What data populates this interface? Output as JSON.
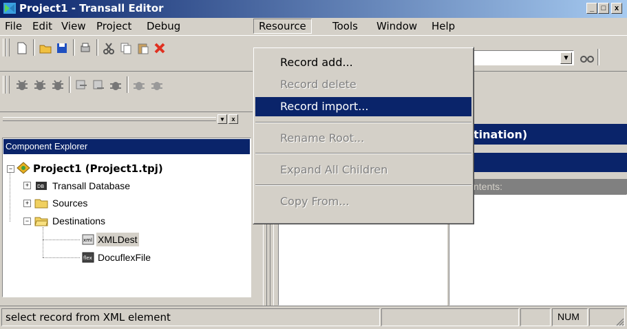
{
  "window": {
    "title": "Project1 - Transall Editor",
    "minimize": "_",
    "maximize": "□",
    "close": "x"
  },
  "menubar": [
    {
      "label": "File"
    },
    {
      "label": "Edit"
    },
    {
      "label": "View"
    },
    {
      "label": "Project"
    },
    {
      "label": "Debug"
    },
    {
      "label": "Resource"
    },
    {
      "label": "Tools"
    },
    {
      "label": "Window"
    },
    {
      "label": "Help"
    }
  ],
  "resource_menu": {
    "items": [
      {
        "label": "Record add...",
        "state": "enabled"
      },
      {
        "label": "Record delete",
        "state": "disabled"
      },
      {
        "label": "Record import...",
        "state": "selected"
      },
      {
        "label": "Rename Root...",
        "state": "disabled"
      },
      {
        "label": "Expand All Children",
        "state": "disabled"
      },
      {
        "label": "Copy From...",
        "state": "disabled"
      }
    ]
  },
  "explorer": {
    "header": "Component Explorer",
    "root": "Project1 (Project1.tpj)",
    "nodes": [
      {
        "label": "Transall Database"
      },
      {
        "label": "Sources"
      },
      {
        "label": "Destinations"
      },
      {
        "label": "XMLDest"
      },
      {
        "label": "DocuflexFile"
      }
    ]
  },
  "right_panel": {
    "title": "tination)",
    "contents_label": "ntents:"
  },
  "statusbar": {
    "text": "select record from XML element",
    "num": "NUM"
  },
  "colors": {
    "titlebar": "#0a246a",
    "highlight": "#0a246a",
    "face": "#d4d0c8"
  }
}
